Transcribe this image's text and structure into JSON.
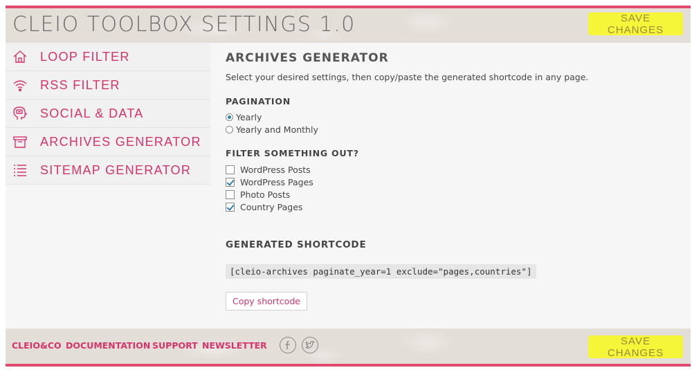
{
  "app": {
    "title": "CLEIO TOOLBOX SETTINGS 1.0",
    "save_label": "SAVE CHANGES",
    "accent": "#d6336c",
    "border": "#e34a6f",
    "save_bg": "#f5f53a"
  },
  "sidebar": {
    "items": [
      {
        "label": "LOOP FILTER",
        "icon": "home-icon"
      },
      {
        "label": "RSS FILTER",
        "icon": "wifi-icon"
      },
      {
        "label": "SOCIAL & DATA",
        "icon": "head-speech-icon"
      },
      {
        "label": "ARCHIVES GENERATOR",
        "icon": "archive-box-icon"
      },
      {
        "label": "SITEMAP GENERATOR",
        "icon": "list-icon"
      }
    ]
  },
  "main": {
    "title": "ARCHIVES GENERATOR",
    "intro": "Select your desired settings, then copy/paste the generated shortcode in any page.",
    "pagination": {
      "heading": "PAGINATION",
      "options": [
        {
          "label": "Yearly",
          "selected": true
        },
        {
          "label": "Yearly and Monthly",
          "selected": false
        }
      ]
    },
    "filter": {
      "heading": "FILTER SOMETHING OUT?",
      "options": [
        {
          "label": "WordPress Posts",
          "checked": false
        },
        {
          "label": "WordPress Pages",
          "checked": true
        },
        {
          "label": "Photo Posts",
          "checked": false
        },
        {
          "label": "Country Pages",
          "checked": true
        }
      ]
    },
    "generated": {
      "heading": "GENERATED SHORTCODE",
      "shortcode": "[cleio-archives paginate_year=1 exclude=\"pages,countries\"]",
      "copy_label": "Copy shortcode"
    }
  },
  "footer": {
    "links": [
      "CLEIO&CO",
      "DOCUMENTATION",
      "SUPPORT",
      "NEWSLETTER"
    ],
    "social": [
      "facebook-icon",
      "twitter-icon"
    ]
  }
}
